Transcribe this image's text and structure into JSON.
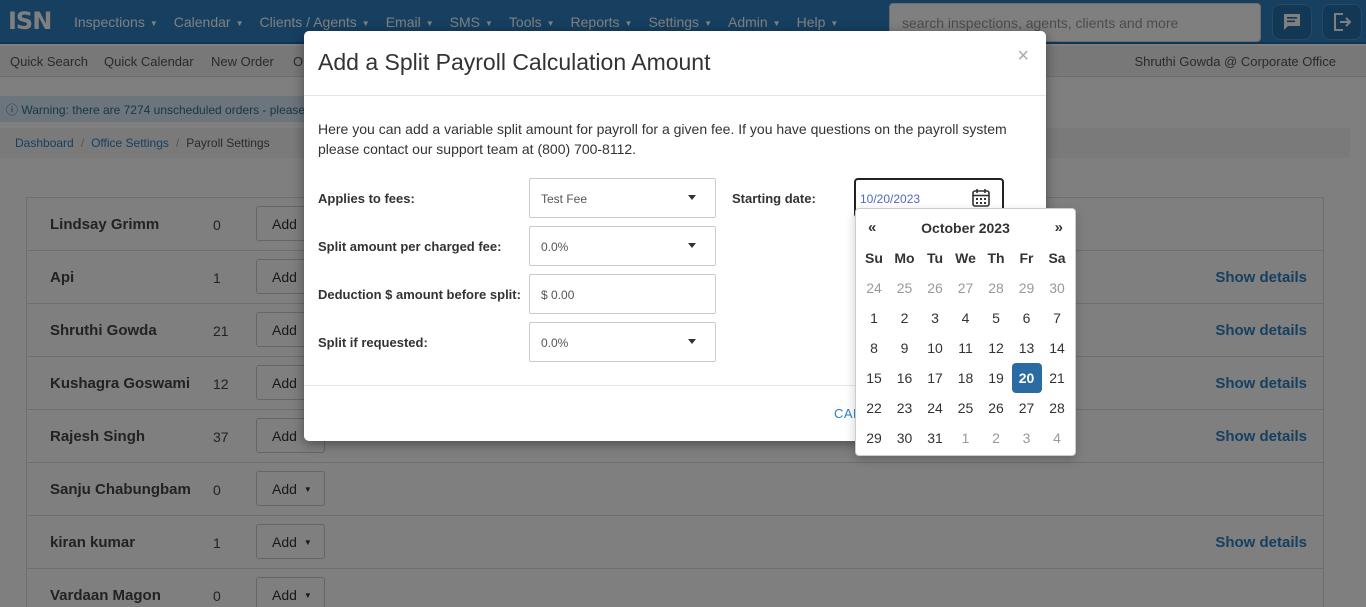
{
  "brand": "ISN",
  "nav": [
    {
      "label": "Inspections"
    },
    {
      "label": "Calendar"
    },
    {
      "label": "Clients / Agents"
    },
    {
      "label": "Email"
    },
    {
      "label": "SMS"
    },
    {
      "label": "Tools"
    },
    {
      "label": "Reports"
    },
    {
      "label": "Settings"
    },
    {
      "label": "Admin"
    },
    {
      "label": "Help"
    }
  ],
  "search": {
    "placeholder": "search inspections, agents, clients and more"
  },
  "subnav": {
    "items": [
      "Quick Search",
      "Quick Calendar",
      "New Order",
      "O"
    ],
    "user": "Shruthi Gowda @ Corporate Office"
  },
  "warning": "Warning: there are 7274 unscheduled orders - please",
  "breadcrumb": [
    "Dashboard",
    "Office Settings",
    "Payroll Settings"
  ],
  "rows": [
    {
      "name": "Lindsay Grimm",
      "count": "0",
      "add": "Add",
      "details": ""
    },
    {
      "name": "Api",
      "count": "1",
      "add": "Add",
      "details": "Show details"
    },
    {
      "name": "Shruthi Gowda",
      "count": "21",
      "add": "Add",
      "details": "Show details"
    },
    {
      "name": "Kushagra Goswami",
      "count": "12",
      "add": "Add",
      "details": "Show details"
    },
    {
      "name": "Rajesh Singh",
      "count": "37",
      "add": "Add",
      "details": "Show details"
    },
    {
      "name": "Sanju Chabungbam",
      "count": "0",
      "add": "Add",
      "details": ""
    },
    {
      "name": "kiran kumar",
      "count": "1",
      "add": "Add",
      "details": "Show details"
    },
    {
      "name": "Vardaan Magon",
      "count": "0",
      "add": "Add",
      "details": ""
    }
  ],
  "modal": {
    "title": "Add a Split Payroll Calculation Amount",
    "close": "×",
    "description": "Here you can add a variable split amount for payroll for a given fee. If you have questions on the payroll system please contact our support team at (800) 700-8112.",
    "fields": {
      "applies_label": "Applies to fees:",
      "applies_value": "Test Fee",
      "split_label": "Split amount per charged fee:",
      "split_value": "0.0%",
      "deduction_label": "Deduction $ amount before split:",
      "deduction_value": "$ 0.00",
      "requested_label": "Split if requested:",
      "requested_value": "0.0%",
      "start_label": "Starting date:",
      "start_value": "10/20/2023"
    },
    "cancel": "CAN"
  },
  "datepicker": {
    "prev": "«",
    "next": "»",
    "month": "October 2023",
    "weekdays": [
      "Su",
      "Mo",
      "Tu",
      "We",
      "Th",
      "Fr",
      "Sa"
    ],
    "weeks": [
      [
        "24",
        "25",
        "26",
        "27",
        "28",
        "29",
        "30"
      ],
      [
        "1",
        "2",
        "3",
        "4",
        "5",
        "6",
        "7"
      ],
      [
        "8",
        "9",
        "10",
        "11",
        "12",
        "13",
        "14"
      ],
      [
        "15",
        "16",
        "17",
        "18",
        "19",
        "20",
        "21"
      ],
      [
        "22",
        "23",
        "24",
        "25",
        "26",
        "27",
        "28"
      ],
      [
        "29",
        "30",
        "31",
        "1",
        "2",
        "3",
        "4"
      ]
    ],
    "selected": "20"
  },
  "colors": {
    "nav": "#2d7fc1",
    "selected": "#2a6ba4",
    "link": "#2d7fc1"
  }
}
